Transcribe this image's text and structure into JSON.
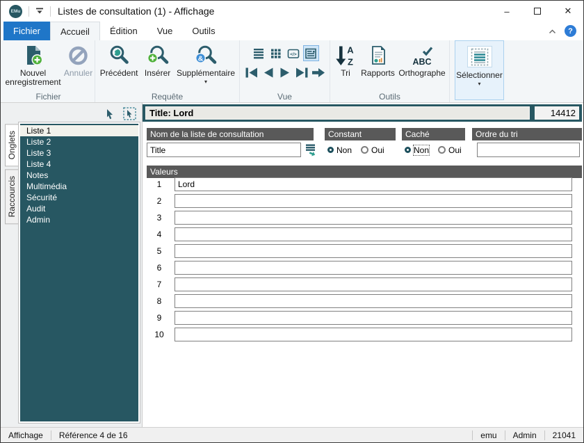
{
  "titlebar": {
    "app_logo": "EMu",
    "title": "Listes de consultation (1) - Affichage"
  },
  "tabs": {
    "fichier": "Fichier",
    "accueil": "Accueil",
    "edition": "Édition",
    "vue": "Vue",
    "outils": "Outils"
  },
  "ribbon": {
    "new_record": "Nouvel enregistrement",
    "undo": "Annuler",
    "group_fichier": "Fichier",
    "previous": "Précédent",
    "insert": "Insérer",
    "additional": "Supplémentaire",
    "group_requete": "Requête",
    "group_vue": "Vue",
    "sort": "Tri",
    "reports": "Rapports",
    "spelling": "Orthographe",
    "group_outils": "Outils",
    "select": "Sélectionner"
  },
  "glyphs": {
    "code": "</>",
    "sort_a": "A",
    "sort_z": "Z",
    "abc": "ABC",
    "amp": "&",
    "help": "?",
    "minimize": "–",
    "close": "✕",
    "caret": "▾"
  },
  "sidebar": {
    "tab_onglets": "Onglets",
    "tab_raccourcis": "Raccourcis",
    "selected_index": 0,
    "items": [
      "Liste 1",
      "Liste 2",
      "Liste 3",
      "Liste 4",
      "Notes",
      "Multimédia",
      "Sécurité",
      "Audit",
      "Admin"
    ]
  },
  "record": {
    "summary": "Title: Lord",
    "number": "14412"
  },
  "form": {
    "name_label": "Nom de la liste de consultation",
    "name_value": "Title",
    "constant_label": "Constant",
    "option_non": "Non",
    "option_oui": "Oui",
    "hidden_label": "Caché",
    "sort_order_label": "Ordre du tri",
    "sort_order_value": "",
    "values_label": "Valeurs",
    "values": [
      {
        "n": "1",
        "v": "Lord"
      },
      {
        "n": "2",
        "v": ""
      },
      {
        "n": "3",
        "v": ""
      },
      {
        "n": "4",
        "v": ""
      },
      {
        "n": "5",
        "v": ""
      },
      {
        "n": "6",
        "v": ""
      },
      {
        "n": "7",
        "v": ""
      },
      {
        "n": "8",
        "v": ""
      },
      {
        "n": "9",
        "v": ""
      },
      {
        "n": "10",
        "v": ""
      }
    ]
  },
  "statusbar": {
    "mode": "Affichage",
    "reference": "Référence 4 de 16",
    "right": [
      "emu",
      "Admin",
      "21041"
    ]
  },
  "colors": {
    "teal_icon": "#2C5D6C",
    "panel_teal": "#275762",
    "tab_blue": "#1F76C8",
    "label_bar": "#595959",
    "green_badge": "#4FB13A",
    "blue_badge": "#3E8ED6",
    "select_highlight": "#e7f2fb"
  }
}
